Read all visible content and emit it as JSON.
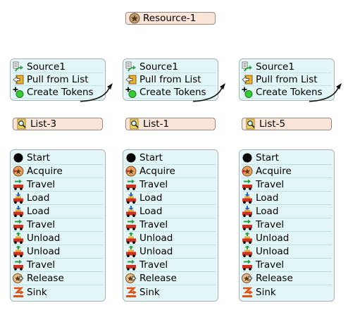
{
  "resource": {
    "label": "Resource-1",
    "icon": "resource-star-icon"
  },
  "columns": [
    {
      "source_activities": [
        {
          "label": "Source1",
          "icon": "source-icon"
        },
        {
          "label": "Pull from List",
          "icon": "pull-from-list-icon"
        },
        {
          "label": "Create Tokens",
          "icon": "create-tokens-icon"
        }
      ],
      "list": {
        "label": "List-3",
        "icon": "list-magnifier-icon"
      },
      "process_activities": [
        {
          "label": "Start",
          "icon": "start-icon"
        },
        {
          "label": "Acquire",
          "icon": "acquire-icon"
        },
        {
          "label": "Travel",
          "icon": "travel-icon"
        },
        {
          "label": "Load",
          "icon": "load-icon"
        },
        {
          "label": "Load",
          "icon": "load-icon"
        },
        {
          "label": "Travel",
          "icon": "travel-icon"
        },
        {
          "label": "Unload",
          "icon": "unload-icon"
        },
        {
          "label": "Unload",
          "icon": "unload-icon"
        },
        {
          "label": "Travel",
          "icon": "travel-icon"
        },
        {
          "label": "Release",
          "icon": "release-icon"
        },
        {
          "label": "Sink",
          "icon": "sink-icon"
        }
      ]
    },
    {
      "source_activities": [
        {
          "label": "Source1",
          "icon": "source-icon"
        },
        {
          "label": "Pull from List",
          "icon": "pull-from-list-icon"
        },
        {
          "label": "Create Tokens",
          "icon": "create-tokens-icon"
        }
      ],
      "list": {
        "label": "List-1",
        "icon": "list-magnifier-icon"
      },
      "process_activities": [
        {
          "label": "Start",
          "icon": "start-icon"
        },
        {
          "label": "Acquire",
          "icon": "acquire-icon"
        },
        {
          "label": "Travel",
          "icon": "travel-icon"
        },
        {
          "label": "Load",
          "icon": "load-icon"
        },
        {
          "label": "Load",
          "icon": "load-icon"
        },
        {
          "label": "Travel",
          "icon": "travel-icon"
        },
        {
          "label": "Unload",
          "icon": "unload-icon"
        },
        {
          "label": "Unload",
          "icon": "unload-icon"
        },
        {
          "label": "Travel",
          "icon": "travel-icon"
        },
        {
          "label": "Release",
          "icon": "release-icon"
        },
        {
          "label": "Sink",
          "icon": "sink-icon"
        }
      ]
    },
    {
      "source_activities": [
        {
          "label": "Source1",
          "icon": "source-icon"
        },
        {
          "label": "Pull from List",
          "icon": "pull-from-list-icon"
        },
        {
          "label": "Create Tokens",
          "icon": "create-tokens-icon"
        }
      ],
      "list": {
        "label": "List-5",
        "icon": "list-magnifier-icon"
      },
      "process_activities": [
        {
          "label": "Start",
          "icon": "start-icon"
        },
        {
          "label": "Acquire",
          "icon": "acquire-icon"
        },
        {
          "label": "Travel",
          "icon": "travel-icon"
        },
        {
          "label": "Load",
          "icon": "load-icon"
        },
        {
          "label": "Load",
          "icon": "load-icon"
        },
        {
          "label": "Travel",
          "icon": "travel-icon"
        },
        {
          "label": "Unload",
          "icon": "unload-icon"
        },
        {
          "label": "Unload",
          "icon": "unload-icon"
        },
        {
          "label": "Travel",
          "icon": "travel-icon"
        },
        {
          "label": "Release",
          "icon": "release-icon"
        },
        {
          "label": "Sink",
          "icon": "sink-icon"
        }
      ]
    }
  ]
}
